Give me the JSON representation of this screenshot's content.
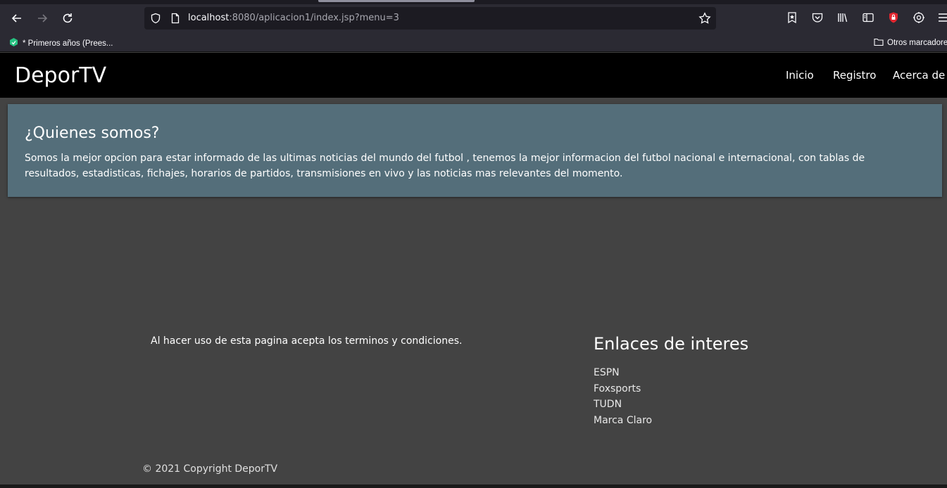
{
  "browser": {
    "url_host": "localhost",
    "url_rest": ":8080/aplicacion1/index.jsp?menu=3",
    "bookmarks": {
      "left_item": "* Primeros años (Prees...",
      "right_item": "Otros marcadores"
    }
  },
  "navbar": {
    "brand": "DeporTV",
    "links": [
      "Inicio",
      "Registro",
      "Acerca de"
    ]
  },
  "jumbotron": {
    "title": "¿Quienes somos?",
    "text": "Somos la mejor opcion para estar informado de las ultimas noticias del mundo del futbol , tenemos la mejor informacion del futbol nacional e internacional, con tablas de resultados, estadisticas, fichajes, horarios de partidos, transmisiones en vivo y las noticias mas relevantes del momento."
  },
  "footer": {
    "terms": "Al hacer uso de esta pagina acepta los terminos y condiciones.",
    "links_title": "Enlaces de interes",
    "links": [
      "ESPN",
      "Foxsports",
      "TUDN",
      "Marca Claro"
    ],
    "copyright": "© 2021 Copyright DeporTV"
  },
  "colors": {
    "page_bg": "#434343",
    "navbar_bg": "#000000",
    "jumbotron_bg": "#546e7a"
  }
}
